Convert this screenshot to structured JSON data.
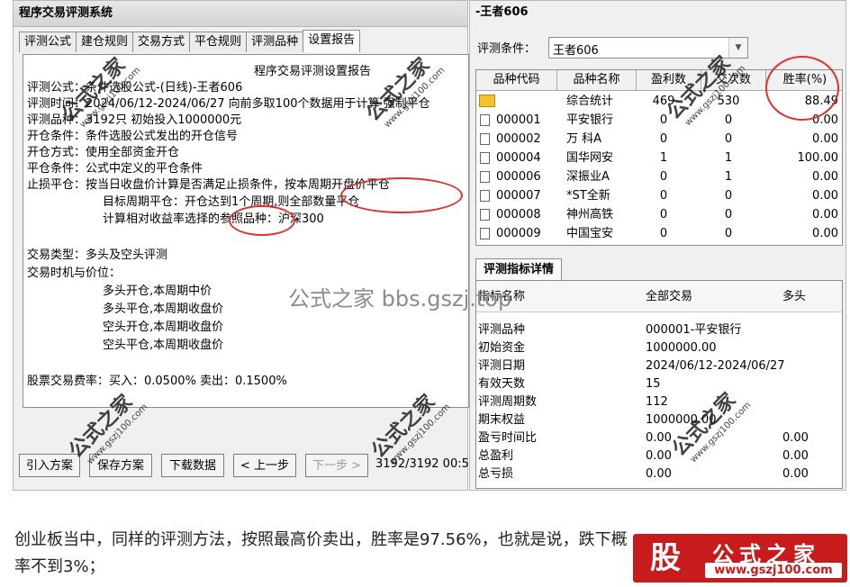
{
  "left": {
    "title": "程序交易评测系统",
    "tabs": [
      "评测公式",
      "建仓规则",
      "交易方式",
      "平仓规则",
      "评测品种",
      "设置报告"
    ],
    "report": {
      "heading": "程序交易评测设置报告",
      "lines": [
        "评测公式：条件选股公式-(日线)-王者606",
        "评测时间：2024/06/12-2024/06/27 向前多取100个数据用于计算 强制平仓",
        "评测品种：3192只 初始投入1000000元",
        "开仓条件：条件选股公式发出的开仓信号",
        "开仓方式：使用全部资金开仓",
        "平仓条件：公式中定义的平仓条件",
        "止损平仓：按当日收盘价计算是否满足止损条件，按本周期开盘价平仓",
        "目标周期平仓：开仓达到1个周期,则全部数量平仓",
        "计算相对收益率选择的参照品种：沪深300",
        "交易类型：多头及空头评测",
        "交易时机与价位：",
        "多头开仓,本周期中价",
        "多头平仓,本周期收盘价",
        "空头开仓,本周期收盘价",
        "空头平仓,本周期收盘价",
        "股票交易费率：买入：0.0500%  卖出：0.1500%"
      ]
    },
    "buttons": [
      "引入方案",
      "保存方案",
      "下载数据",
      "< 上一步",
      "下一步 >"
    ],
    "progress": "3192/3192 00:5"
  },
  "right": {
    "title": "-王者606",
    "cond_label": "评测条件：",
    "cond_value": "王者606",
    "columns": [
      "品种代码",
      "品种名称",
      "盈利数",
      "交次数",
      "胜率(%)"
    ],
    "rows": [
      {
        "code": "",
        "name": "综合统计",
        "profit": "469",
        "trades": "530",
        "rate": "88.49"
      },
      {
        "code": "000001",
        "name": "平安银行",
        "profit": "0",
        "trades": "0",
        "rate": "0.00"
      },
      {
        "code": "000002",
        "name": "万 科A",
        "profit": "0",
        "trades": "0",
        "rate": "0.00"
      },
      {
        "code": "000004",
        "name": "国华网安",
        "profit": "1",
        "trades": "1",
        "rate": "100.00"
      },
      {
        "code": "000006",
        "name": "深振业A",
        "profit": "0",
        "trades": "1",
        "rate": "0.00"
      },
      {
        "code": "000007",
        "name": "*ST全新",
        "profit": "0",
        "trades": "0",
        "rate": "0.00"
      },
      {
        "code": "000008",
        "name": "神州高铁",
        "profit": "0",
        "trades": "0",
        "rate": "0.00"
      },
      {
        "code": "000009",
        "name": "中国宝安",
        "profit": "0",
        "trades": "0",
        "rate": "0.00"
      }
    ],
    "detail_tab": "评测指标详情",
    "detail_head": [
      "指标名称",
      "全部交易",
      "多头"
    ],
    "detail_rows": [
      {
        "name": "评测品种",
        "all": "000001-平安银行",
        "long": ""
      },
      {
        "name": "初始资金",
        "all": "1000000.00",
        "long": ""
      },
      {
        "name": "评测日期",
        "all": "2024/06/12-2024/06/27",
        "long": ""
      },
      {
        "name": "有效天数",
        "all": "15",
        "long": ""
      },
      {
        "name": "评测周期数",
        "all": "112",
        "long": ""
      },
      {
        "name": "期末权益",
        "all": "1000000.00",
        "long": ""
      },
      {
        "name": "盈亏时间比",
        "all": "0.00",
        "long": "0.00"
      },
      {
        "name": "总盈利",
        "all": "0.00",
        "long": "0.00"
      },
      {
        "name": "总亏损",
        "all": "0.00",
        "long": "0.00"
      }
    ]
  },
  "watermark": {
    "name": "公式之家",
    "url": "www.gszj100.com",
    "center": "公式之家 bbs.gszj.top"
  },
  "caption": "创业板当中，同样的评测方法，按照最高价卖出，胜率是97.56%，也就是说，跌下概率不到3%；",
  "logo": {
    "gu": "股",
    "name": "公式之家",
    "url": "www.gszj100.com"
  },
  "colors": {
    "circle": "#e03030",
    "logo_bg": "#c81b1b"
  }
}
